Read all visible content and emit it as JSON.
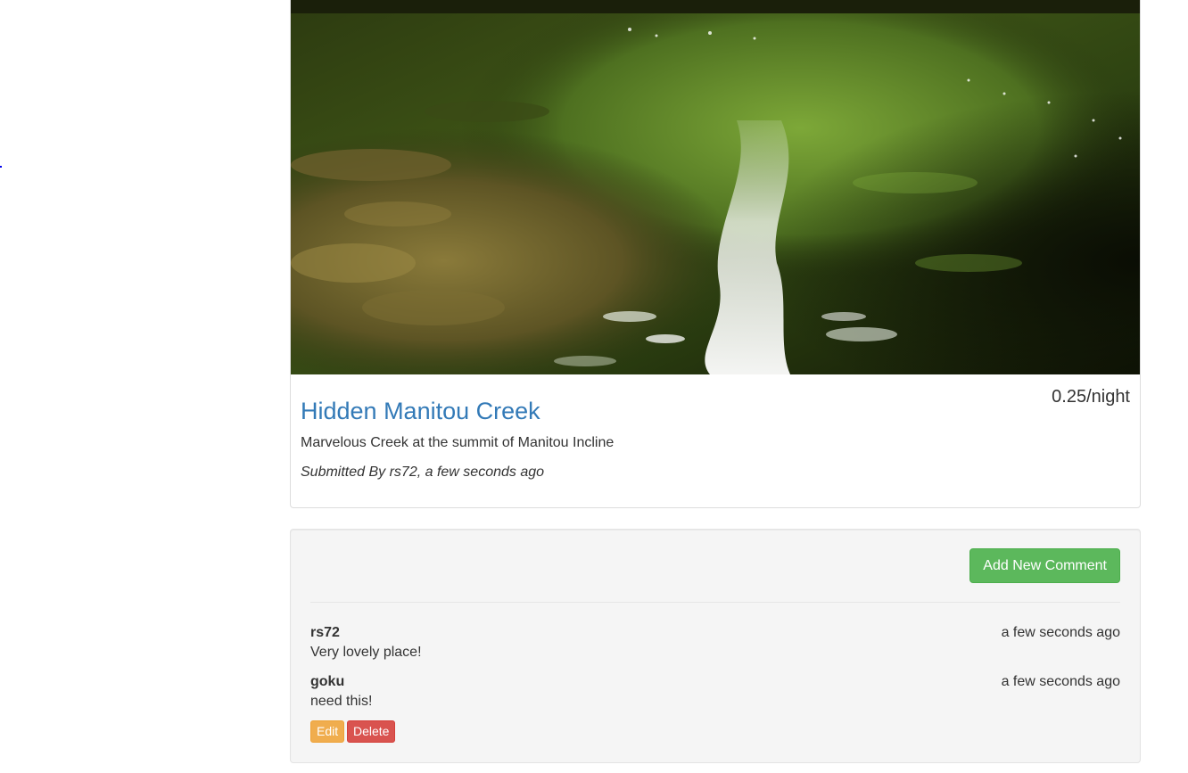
{
  "campground": {
    "name": "Hidden Manitou Creek",
    "price": "0.25/night",
    "description": "Marvelous Creek at the summit of Manitou Incline",
    "submitted": "Submitted By rs72, a few seconds ago",
    "image_alt": "Hidden Manitou Creek"
  },
  "comments_panel": {
    "add_button_label": "Add New Comment",
    "comments": [
      {
        "author": "rs72",
        "time": "a few seconds ago",
        "text": "Very lovely place!"
      },
      {
        "author": "goku",
        "time": "a few seconds ago",
        "text": "need this!"
      }
    ],
    "edit_label": "Edit",
    "delete_label": "Delete"
  },
  "colors": {
    "link": "#337ab7",
    "success": "#5cb85c",
    "warning": "#f0ad4e",
    "danger": "#d9534f"
  }
}
